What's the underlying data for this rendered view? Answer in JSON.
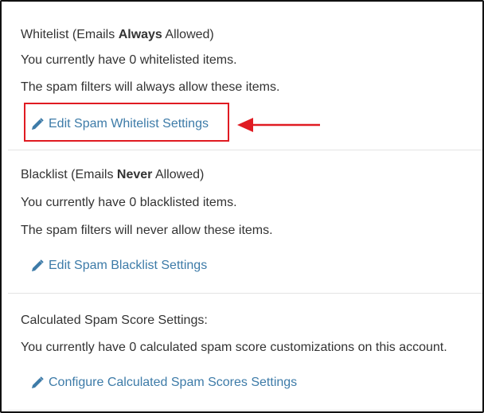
{
  "whitelist": {
    "title_prefix": "Whitelist (Emails ",
    "title_emphasis": "Always",
    "title_suffix": " Allowed)",
    "count_text": "You currently have 0 whitelisted items.",
    "description": "The spam filters will always allow these items.",
    "edit_link": "Edit Spam Whitelist Settings"
  },
  "blacklist": {
    "title_prefix": "Blacklist (Emails ",
    "title_emphasis": "Never",
    "title_suffix": " Allowed)",
    "count_text": "You currently have 0 blacklisted items.",
    "description": "The spam filters will never allow these items.",
    "edit_link": "Edit Spam Blacklist Settings"
  },
  "calculated": {
    "title": "Calculated Spam Score Settings:",
    "description": "You currently have 0 calculated spam score customizations on this account.",
    "configure_link": "Configure Calculated Spam Scores Settings"
  },
  "colors": {
    "link": "#3d7ba8",
    "highlight": "#e01b22",
    "text": "#333333"
  },
  "icons": {
    "edit": "pencil-icon",
    "pointer": "arrow-left-icon"
  }
}
